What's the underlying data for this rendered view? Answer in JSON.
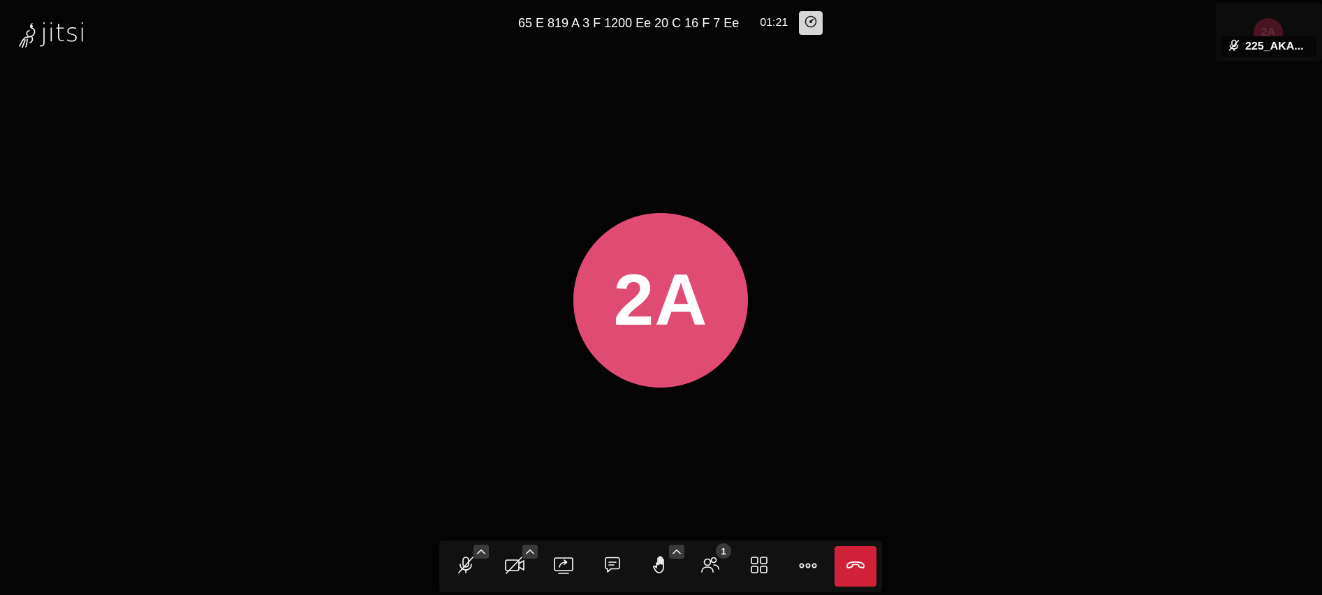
{
  "app": {
    "logo_text": "jitsi"
  },
  "header": {
    "meeting_title": "65 E 819 A 3 F 1200 Ee 20 C 16 F 7 Ee",
    "timer": "01:21",
    "stats_icon": "gauge-icon"
  },
  "thumbnail": {
    "initials": "2A",
    "display_name": "225_AKA...",
    "mic_icon": "mic-muted-icon"
  },
  "main_avatar": {
    "initials": "2A",
    "color": "#e04b73"
  },
  "toolbar": {
    "background": "#111111",
    "hangup_color": "#cf2137",
    "participants_count": "1",
    "buttons": [
      {
        "name": "microphone",
        "icon": "mic-muted-icon",
        "has_menu": true
      },
      {
        "name": "camera",
        "icon": "camera-off-icon",
        "has_menu": true
      },
      {
        "name": "share-screen",
        "icon": "screen-share-icon",
        "has_menu": false
      },
      {
        "name": "chat",
        "icon": "chat-icon",
        "has_menu": false
      },
      {
        "name": "raise-hand",
        "icon": "hand-icon",
        "has_menu": true
      },
      {
        "name": "participants",
        "icon": "participants-icon",
        "has_menu": false
      },
      {
        "name": "tile-view",
        "icon": "grid-icon",
        "has_menu": false
      },
      {
        "name": "more-actions",
        "icon": "more-icon",
        "has_menu": false
      },
      {
        "name": "hangup",
        "icon": "phone-hangup-icon",
        "has_menu": false
      }
    ]
  }
}
